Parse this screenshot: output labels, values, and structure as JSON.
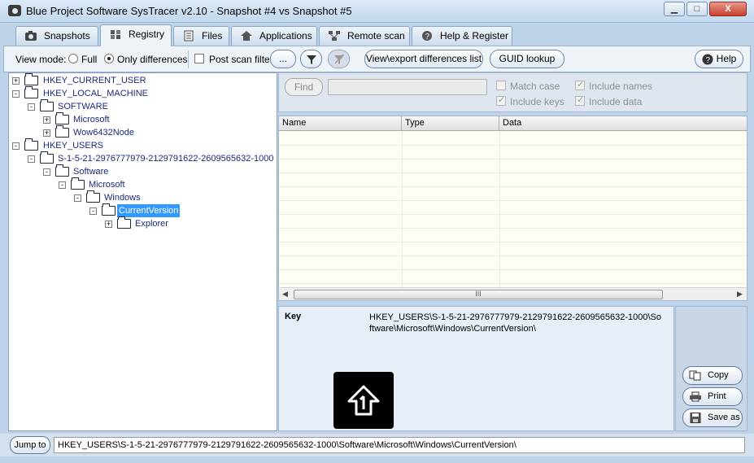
{
  "window": {
    "title": "Blue Project Software SysTracer v2.10 - Snapshot #4 vs Snapshot #5",
    "controls": {
      "minimize": "▁",
      "maximize": "□",
      "close": "X"
    }
  },
  "tabs": [
    {
      "label": "Snapshots",
      "icon": "camera-icon"
    },
    {
      "label": "Registry",
      "icon": "registry-icon",
      "active": true
    },
    {
      "label": "Files",
      "icon": "files-icon"
    },
    {
      "label": "Applications",
      "icon": "applications-icon"
    },
    {
      "label": "Remote scan",
      "icon": "network-icon"
    },
    {
      "label": "Help & Register",
      "icon": "help-icon"
    }
  ],
  "toolbar": {
    "view_mode_label": "View mode:",
    "full_label": "Full",
    "only_differences_label": "Only differences",
    "view_mode_selected": "Only differences",
    "post_scan_filter_label": "Post scan filter",
    "post_scan_filter_checked": false,
    "more_label": "...",
    "export_label": "View\\export differences list",
    "guid_label": "GUID lookup",
    "help_label": "Help"
  },
  "tree": {
    "items": [
      {
        "label": "HKEY_CURRENT_USER",
        "expander": "+"
      },
      {
        "label": "HKEY_LOCAL_MACHINE",
        "expander": "-"
      },
      {
        "label": "SOFTWARE",
        "expander": "-"
      },
      {
        "label": "Microsoft",
        "expander": "+"
      },
      {
        "label": "Wow6432Node",
        "expander": "+"
      },
      {
        "label": "HKEY_USERS",
        "expander": "-"
      },
      {
        "label": "S-1-5-21-2976777979-2129791622-2609565632-1000",
        "expander": "-"
      },
      {
        "label": "Software",
        "expander": "-"
      },
      {
        "label": "Microsoft",
        "expander": "-"
      },
      {
        "label": "Windows",
        "expander": "-"
      },
      {
        "label": "CurrentVersion",
        "expander": "-",
        "selected": true
      },
      {
        "label": "Explorer",
        "expander": "+"
      }
    ]
  },
  "find": {
    "button_label": "Find",
    "input_value": "",
    "match_case_label": "Match case",
    "include_names_label": "Include names",
    "include_keys_label": "Include keys",
    "include_data_label": "Include data",
    "match_case_checked": false,
    "include_names_checked": true,
    "include_keys_checked": true,
    "include_data_checked": true
  },
  "grid": {
    "columns": [
      "Name",
      "Type",
      "Data"
    ],
    "scroll_thumb_label": "III",
    "scroll_left": "◀",
    "scroll_right": "▶"
  },
  "details": {
    "key_label": "Key",
    "key_value": "HKEY_USERS\\S-1-5-21-2976777979-2129791622-2609565632-1000\\Software\\Microsoft\\Windows\\CurrentVersion\\"
  },
  "actions": {
    "copy_label": "Copy",
    "print_label": "Print",
    "save_label": "Save as"
  },
  "bottom": {
    "jump_label": "Jump to",
    "path_value": "HKEY_USERS\\S-1-5-21-2976777979-2129791622-2609565632-1000\\Software\\Microsoft\\Windows\\CurrentVersion\\"
  }
}
